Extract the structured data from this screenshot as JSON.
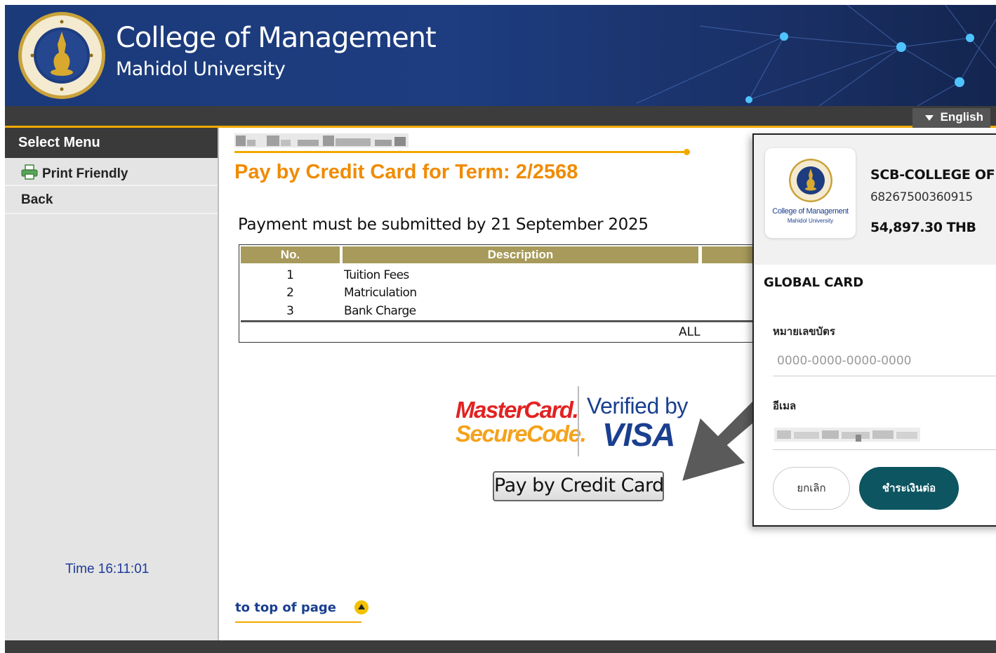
{
  "header": {
    "title": "College of Management",
    "subtitle": "Mahidol University"
  },
  "lang_bar": {
    "language": "English"
  },
  "sidebar": {
    "heading": "Select Menu",
    "items": [
      {
        "label": "Print Friendly",
        "icon": "printer-icon"
      },
      {
        "label": "Back"
      }
    ],
    "time": "Time 16:11:01"
  },
  "main": {
    "title": "Pay by Credit Card for Term: 2/2568",
    "deadline": "Payment must be submitted by 21 September 2025",
    "table": {
      "headers": [
        "No.",
        "Description"
      ],
      "rows": [
        {
          "no": "1",
          "description": "Tuition Fees"
        },
        {
          "no": "2",
          "description": "Matriculation"
        },
        {
          "no": "3",
          "description": "Bank Charge"
        }
      ],
      "total_label": "ALL"
    },
    "logos": {
      "mastercard_line1": "MasterCard.",
      "mastercard_line2": "SecureCode.",
      "visa_line1": "Verified by",
      "visa_line2": "VISA"
    },
    "pay_button": "Pay by Credit Card",
    "to_top": "to top of page"
  },
  "payment_popup": {
    "merchant_logo_line1": "College of Management",
    "merchant_logo_line2": "Mahidol University",
    "merchant_name": "SCB-COLLEGE OF",
    "reference": "68267500360915",
    "amount": "54,897.30 THB",
    "section_title": "GLOBAL CARD",
    "card_label": "หมายเลขบัตร",
    "card_placeholder": "0000-0000-0000-0000",
    "email_label": "อีเมล",
    "cancel_label": "ยกเลิก",
    "continue_label": "ชำระเงินต่อ"
  },
  "colors": {
    "header_bg": "#1d3d80",
    "accent_orange": "#f08b00",
    "table_header": "#a79a5a",
    "continue_button": "#0d5561"
  }
}
